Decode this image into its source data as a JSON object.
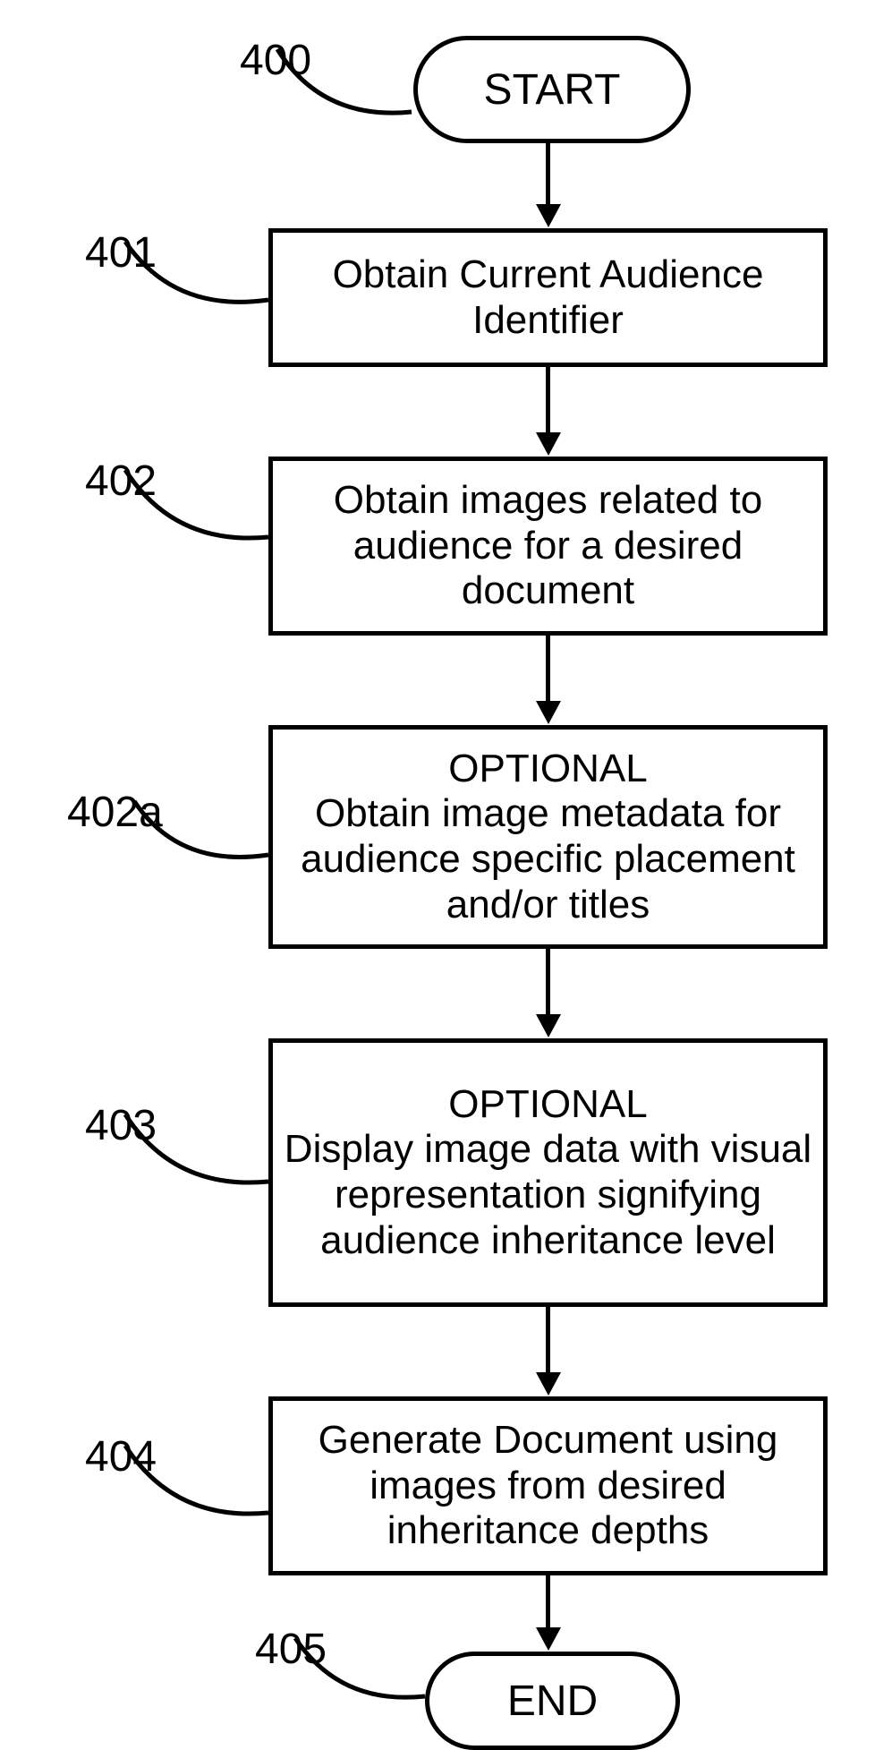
{
  "flow": {
    "start": {
      "label": "START",
      "ref": "400"
    },
    "step1": {
      "text": "Obtain Current Audience Identifier",
      "ref": "401"
    },
    "step2": {
      "text": "Obtain images related to audience for a desired document",
      "ref": "402"
    },
    "step2a": {
      "prefix": "OPTIONAL",
      "text": "Obtain image metadata for audience specific placement and/or titles",
      "ref": "402a"
    },
    "step3": {
      "prefix": "OPTIONAL",
      "text": "Display image data with visual representation signifying audience inheritance level",
      "ref": "403"
    },
    "step4": {
      "text": "Generate Document using images from desired inheritance depths",
      "ref": "404"
    },
    "end": {
      "label": "END",
      "ref": "405"
    }
  }
}
